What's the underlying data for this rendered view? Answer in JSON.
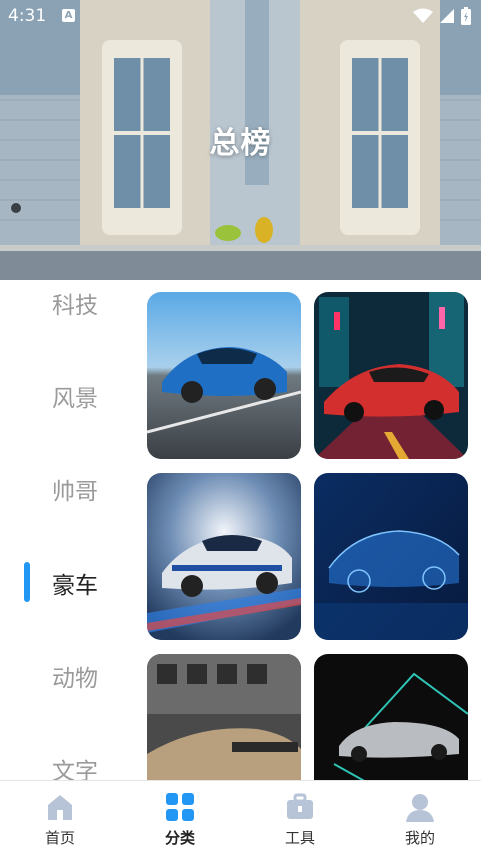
{
  "status": {
    "time": "4:31",
    "a_badge": "A"
  },
  "banner": {
    "title": "总榜"
  },
  "categories": [
    {
      "label": "科技"
    },
    {
      "label": "风景"
    },
    {
      "label": "帅哥"
    },
    {
      "label": "豪车"
    },
    {
      "label": "动物"
    },
    {
      "label": "文字"
    }
  ],
  "active_category": "豪车",
  "tiles": [
    {
      "name": "blue-hypercar",
      "accent": "#2d7fd6"
    },
    {
      "name": "neon-supercar",
      "accent": "#e0303a"
    },
    {
      "name": "race-car-speed",
      "accent": "#3a7bd5"
    },
    {
      "name": "holographic-car",
      "accent": "#1565c0"
    },
    {
      "name": "gold-sports-car",
      "accent": "#b08a5a"
    },
    {
      "name": "classic-limousine",
      "accent": "#2ec4b6"
    }
  ],
  "tabs": [
    {
      "label": "首页",
      "icon": "home-icon"
    },
    {
      "label": "分类",
      "icon": "category-grid-icon"
    },
    {
      "label": "工具",
      "icon": "toolbox-icon"
    },
    {
      "label": "我的",
      "icon": "user-icon"
    }
  ],
  "colors": {
    "accent": "#2196f3",
    "tab_icon_inactive": "#b7c3d6"
  }
}
